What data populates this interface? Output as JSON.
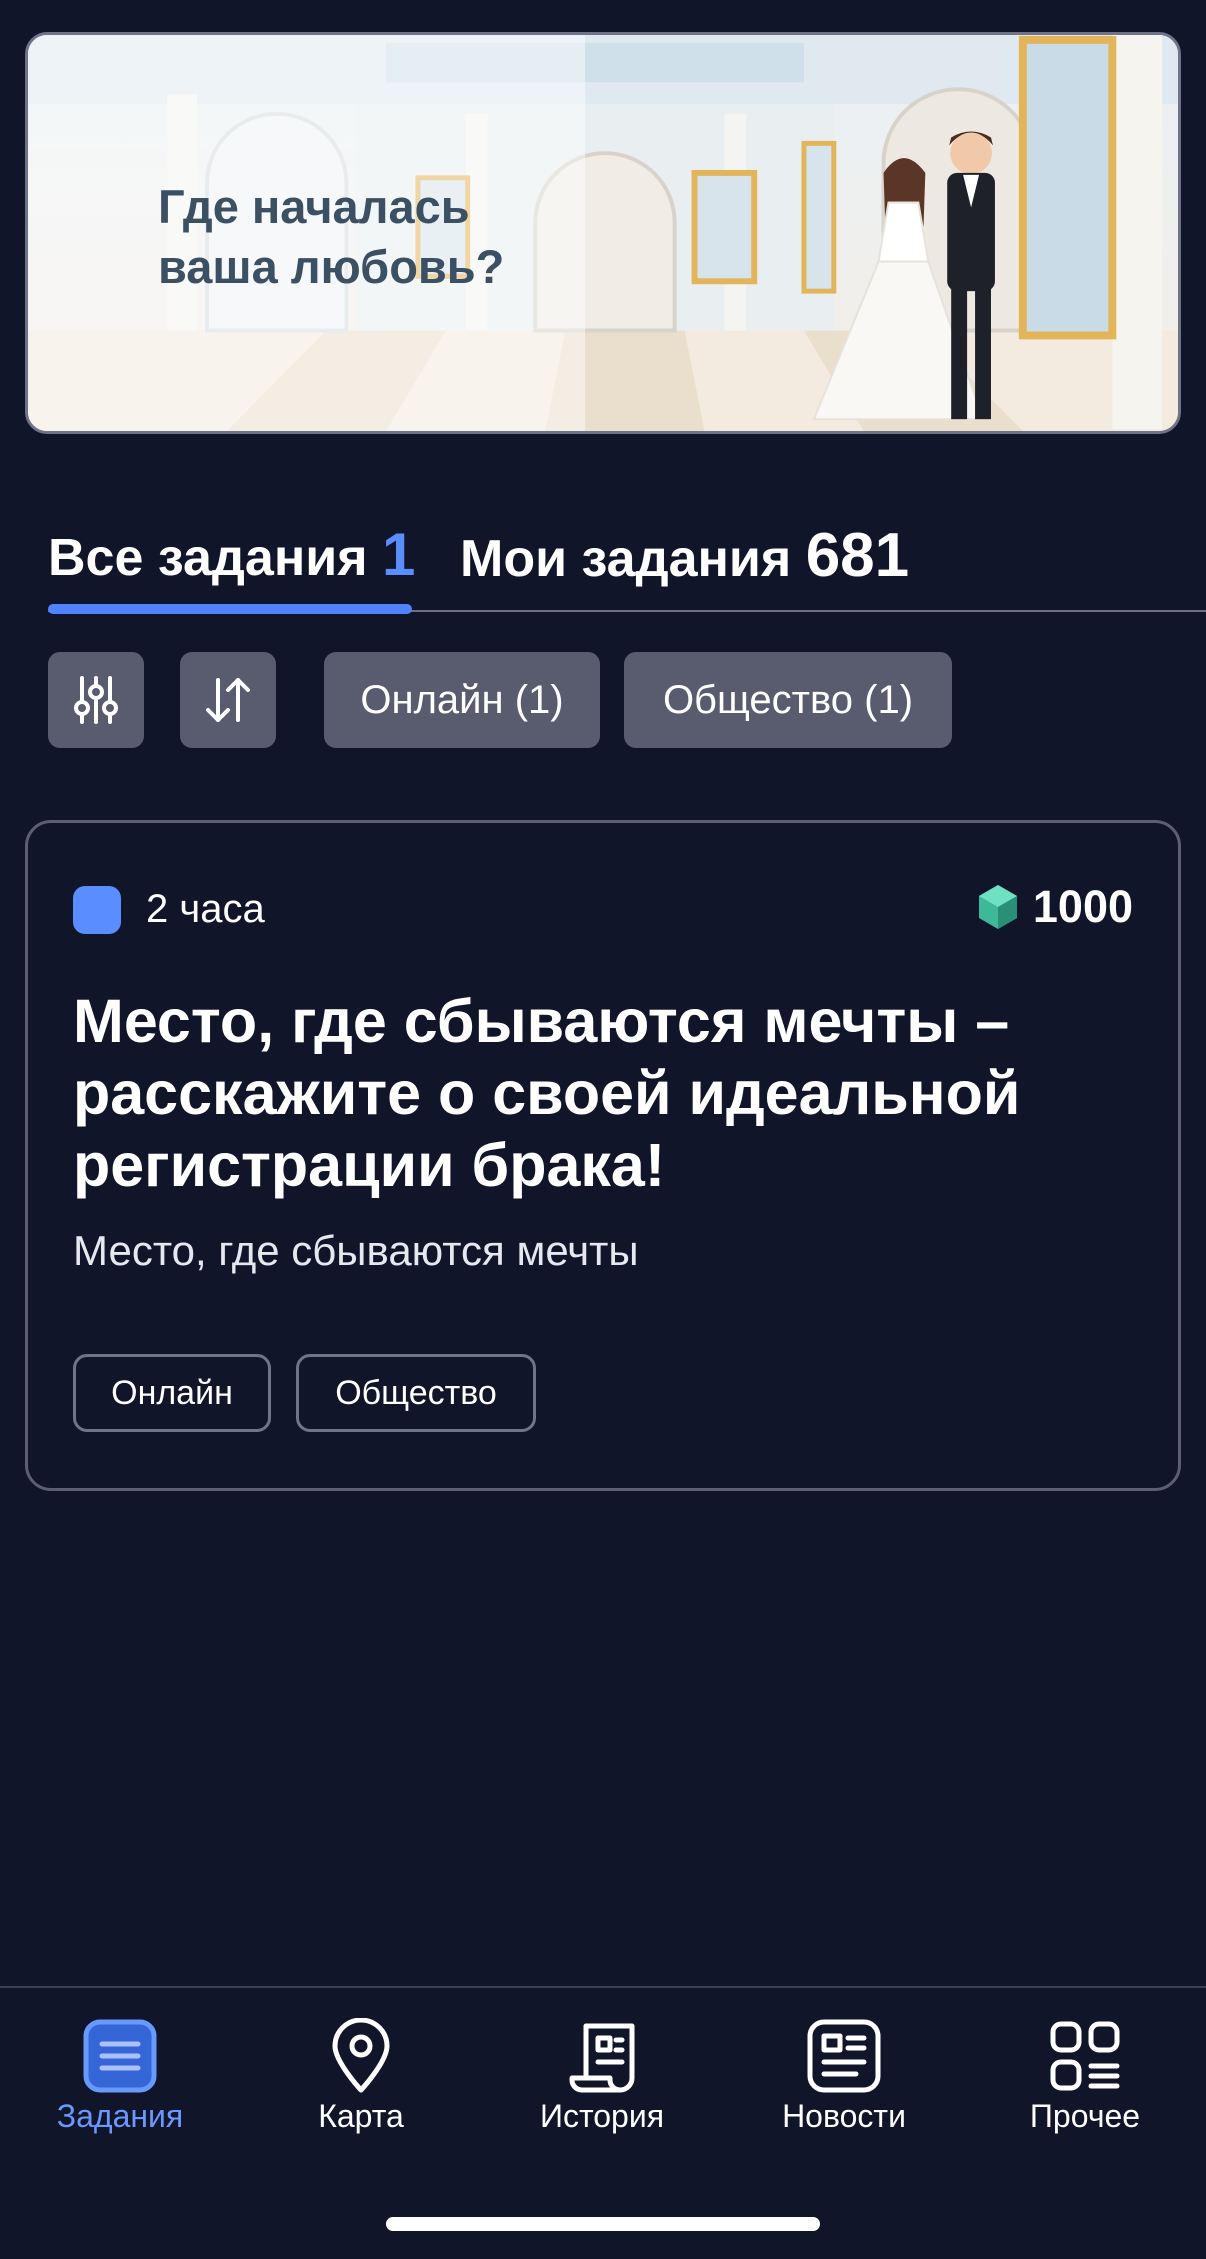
{
  "banner": {
    "title": "Где началась\nваша любовь?"
  },
  "tabs": {
    "all_label": "Все задания",
    "all_count": "1",
    "mine_label": "Мои задания",
    "mine_count": "681"
  },
  "filters": {
    "online_label": "Онлайн (1)",
    "society_label": "Общество (1)"
  },
  "task_card": {
    "time": "2 часа",
    "reward": "1000",
    "title": "Место, где сбываются мечты – расскажите о своей идеальной регистрации брака!",
    "subtitle": "Место, где сбываются мечты",
    "tags": [
      "Онлайн",
      "Общество"
    ]
  },
  "bottom_nav": {
    "items": [
      {
        "label": "Задания",
        "icon": "tasks-icon",
        "active": true
      },
      {
        "label": "Карта",
        "icon": "map-pin-icon",
        "active": false
      },
      {
        "label": "История",
        "icon": "history-icon",
        "active": false
      },
      {
        "label": "Новости",
        "icon": "news-icon",
        "active": false
      },
      {
        "label": "Прочее",
        "icon": "more-icon",
        "active": false
      }
    ]
  },
  "colors": {
    "background": "#11152a",
    "accent": "#5a8dff",
    "chip": "#595c6f",
    "reward_gem": "#3fb89a"
  }
}
